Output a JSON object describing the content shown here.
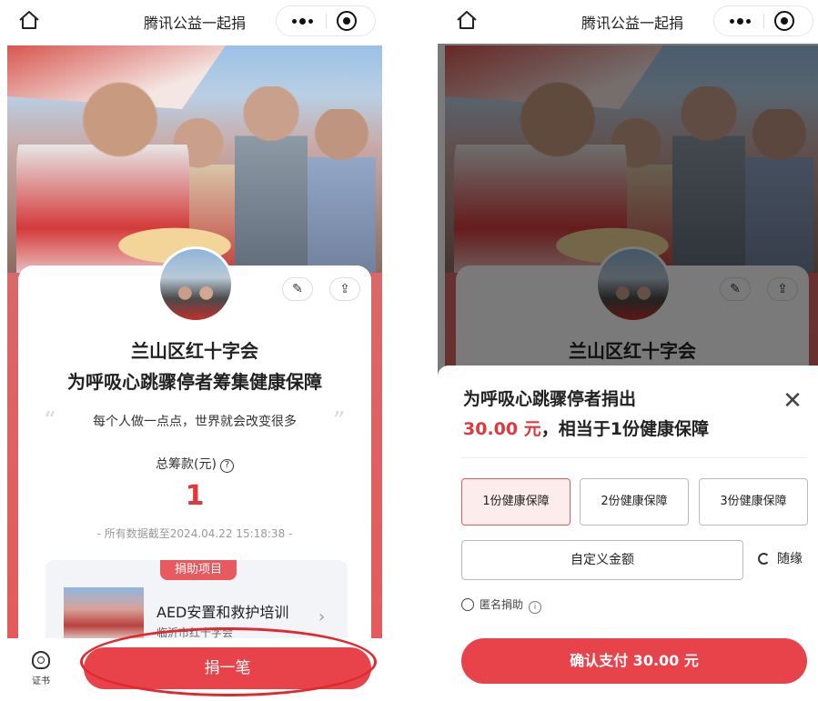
{
  "navbar": {
    "title": "腾讯公益一起捐",
    "home_icon": "home-icon",
    "more_icon": "more-icon",
    "close_icon": "target-close-icon"
  },
  "campaign": {
    "org_name": "兰山区红十字会",
    "title": "为呼吸心跳骤停者筹集健康保障",
    "quote": "每个人做一点点，世界就会改变很多",
    "open_quote": "“",
    "close_quote": "”",
    "total_label": "总筹款(元)",
    "total_value": "1",
    "data_time": "- 所有数据截至2024.04.22 15:18:38 -"
  },
  "project": {
    "tag": "捐助项目",
    "name": "AED安置和救护培训",
    "org": "临沂市红十字会"
  },
  "bottom": {
    "cert_label": "证书",
    "donate_label": "捐一笔"
  },
  "sheet": {
    "title": "为呼吸心跳骤停者捐出",
    "amount": "30.00 元",
    "amount_suffix": "，相当于1份健康保障",
    "options": [
      "1份健康保障",
      "2份健康保障",
      "3份健康保障"
    ],
    "selected_option": "1份健康保障",
    "custom_label": "自定义金额",
    "random_label": "随缘",
    "anon_label": "匿名捐助",
    "confirm_label": "确认支付 30.00 元"
  },
  "colors": {
    "accent": "#e8424b",
    "amount_red": "#e0383e",
    "annotation_red": "#e0282f"
  }
}
